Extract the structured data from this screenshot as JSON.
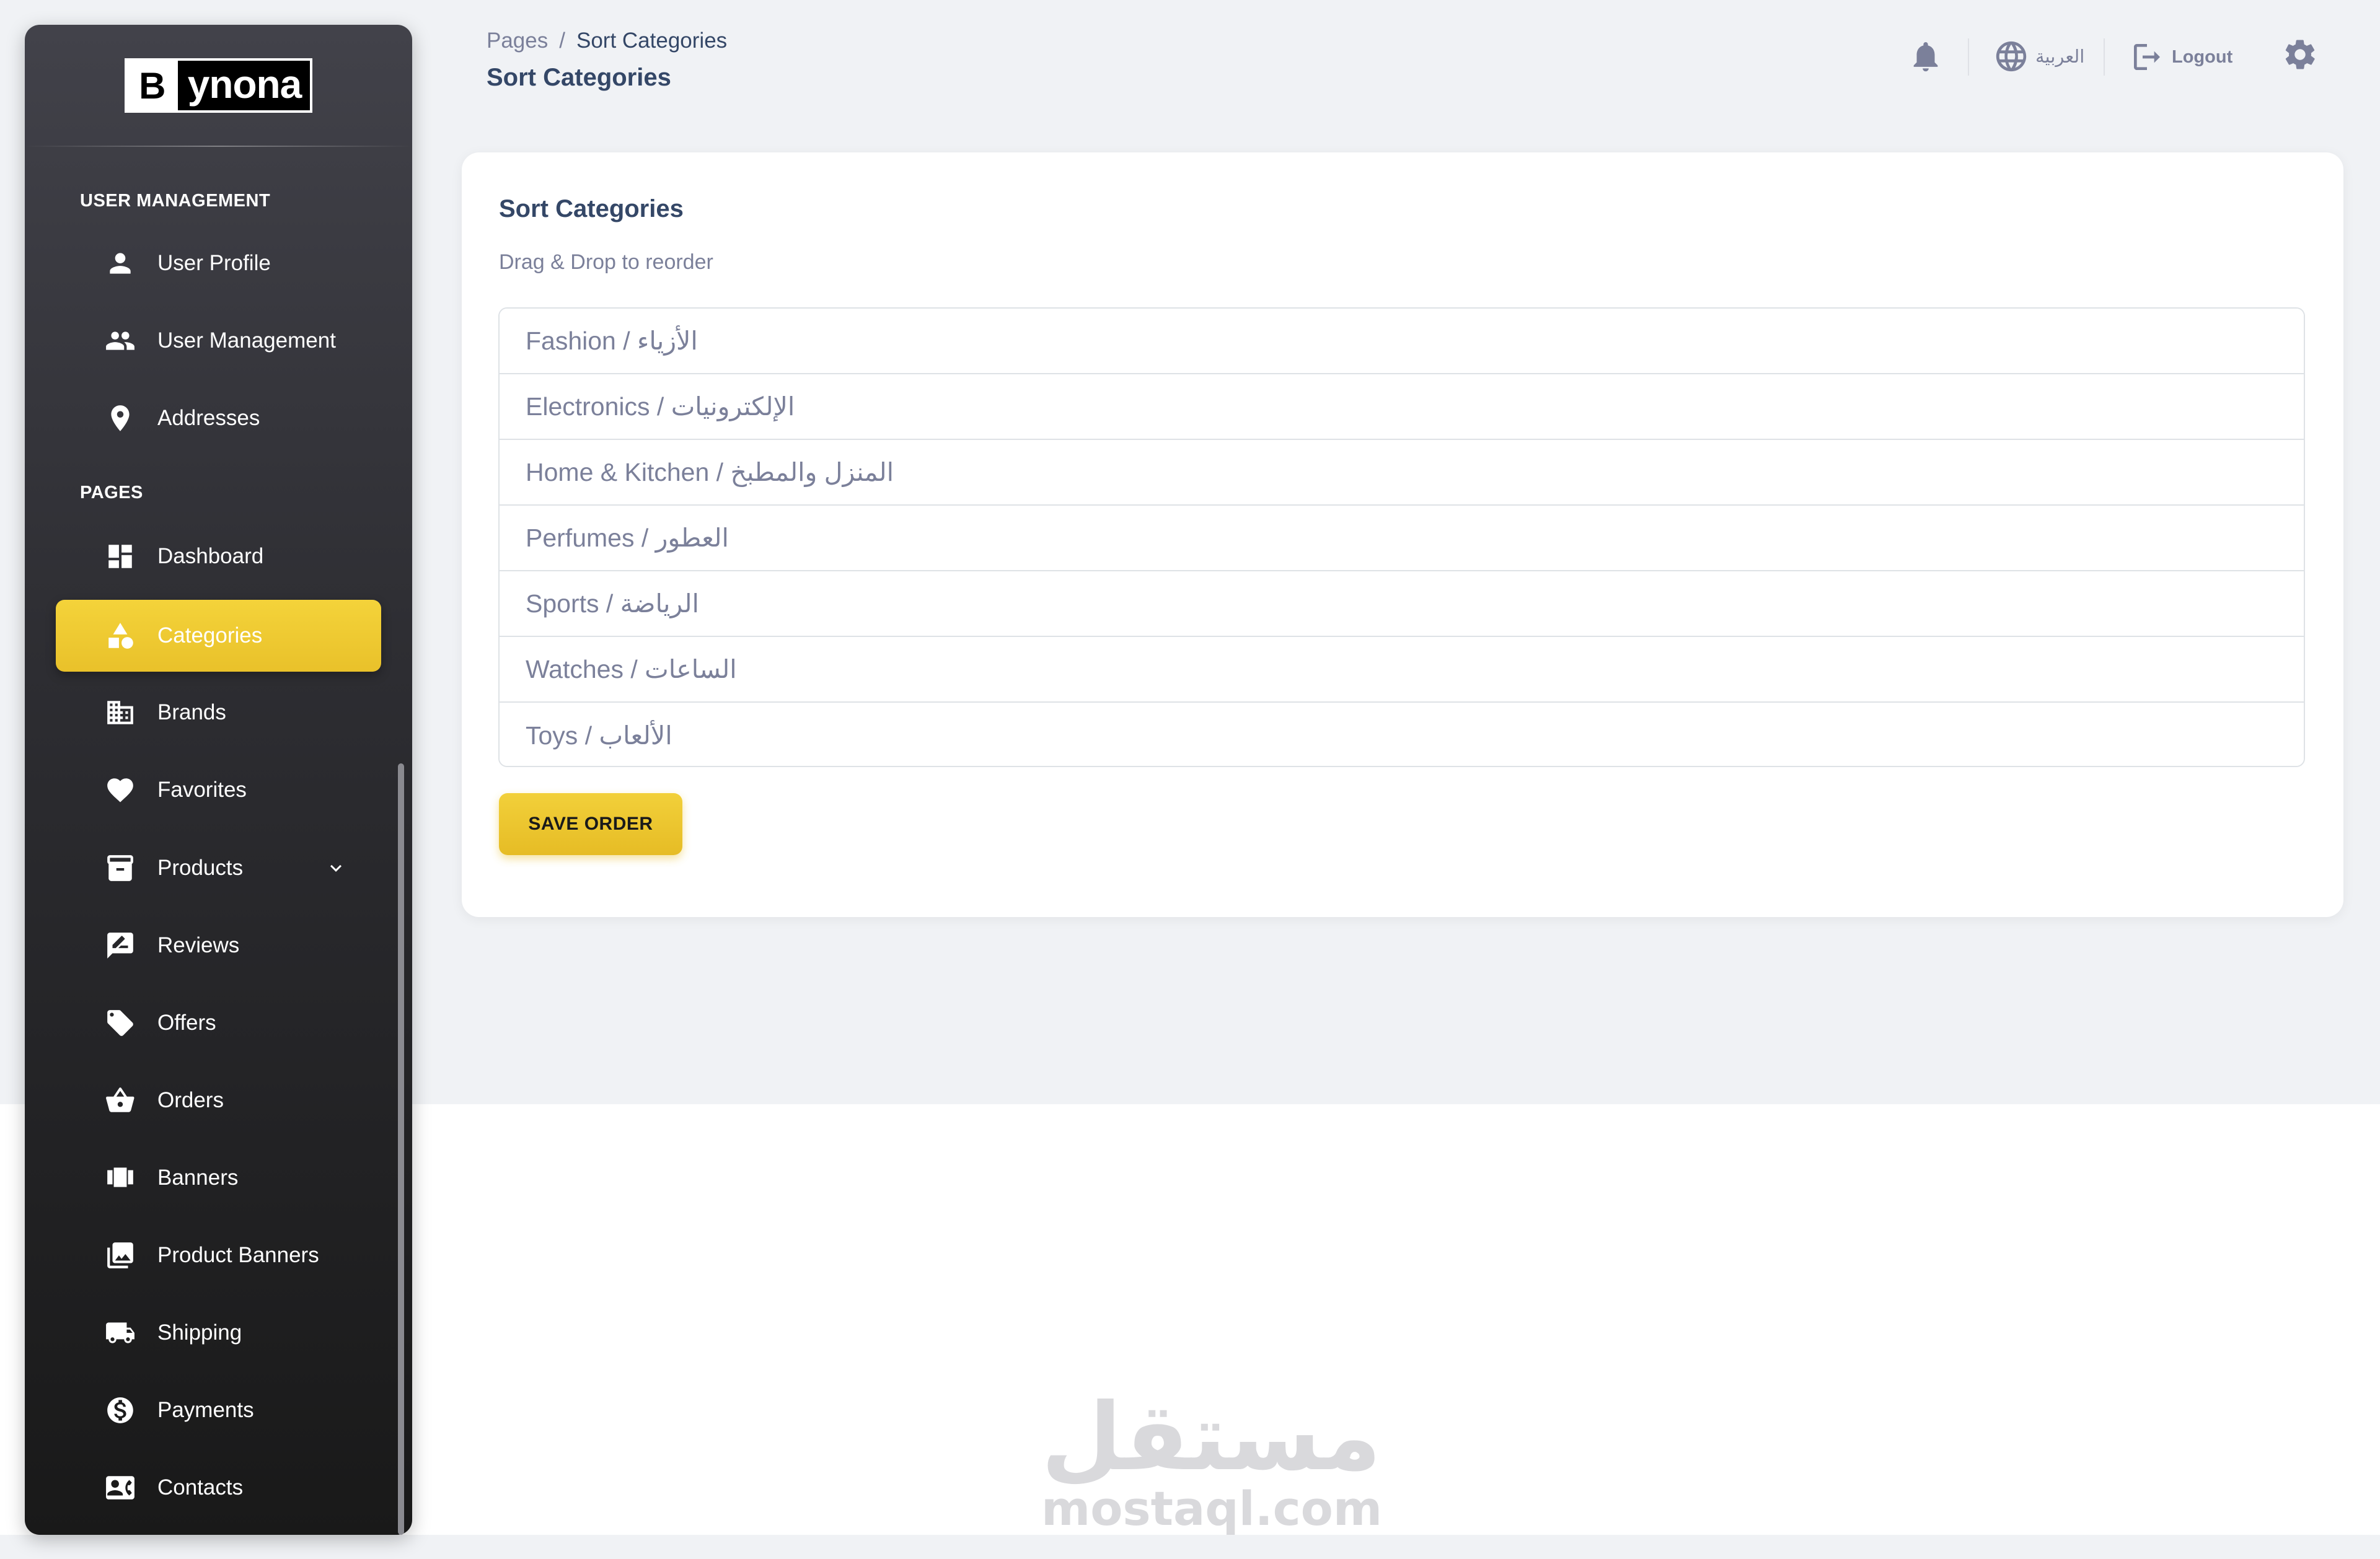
{
  "brand": {
    "logo_letter": "B",
    "logo_text": "ynona"
  },
  "sidebar": {
    "sections": [
      {
        "title": "USER MANAGEMENT"
      },
      {
        "title": "PAGES"
      }
    ],
    "items": [
      {
        "label": "User Profile",
        "icon": "person-icon"
      },
      {
        "label": "User Management",
        "icon": "people-icon"
      },
      {
        "label": "Addresses",
        "icon": "location-pin-icon"
      },
      {
        "label": "Dashboard",
        "icon": "dashboard-icon"
      },
      {
        "label": "Categories",
        "icon": "category-shapes-icon",
        "active": true
      },
      {
        "label": "Brands",
        "icon": "building-icon"
      },
      {
        "label": "Favorites",
        "icon": "heart-icon"
      },
      {
        "label": "Products",
        "icon": "archive-box-icon",
        "expandable": true
      },
      {
        "label": "Reviews",
        "icon": "rate-review-icon"
      },
      {
        "label": "Offers",
        "icon": "tag-icon"
      },
      {
        "label": "Orders",
        "icon": "shopping-basket-icon"
      },
      {
        "label": "Banners",
        "icon": "view-carousel-icon"
      },
      {
        "label": "Product Banners",
        "icon": "photo-library-icon"
      },
      {
        "label": "Shipping",
        "icon": "truck-icon"
      },
      {
        "label": "Payments",
        "icon": "dollar-circle-icon"
      },
      {
        "label": "Contacts",
        "icon": "contact-card-icon"
      }
    ]
  },
  "header": {
    "breadcrumb": {
      "parent": "Pages",
      "separator": "/",
      "current": "Sort Categories"
    },
    "title": "Sort Categories",
    "language_label": "العربية",
    "logout_label": "Logout"
  },
  "card": {
    "title": "Sort Categories",
    "subtitle": "Drag & Drop to reorder",
    "categories": [
      "Fashion / الأزياء",
      "Electronics / الإلكترونيات",
      "Home & Kitchen / المنزل والمطبخ",
      "Perfumes / العطور",
      "Sports / الرياضة",
      "Watches / الساعات",
      "Toys / الألعاب"
    ],
    "save_button": "SAVE ORDER"
  },
  "watermark": {
    "arabic": "مستقل",
    "latin": "mostaql.com"
  },
  "colors": {
    "accent": "#eac52c",
    "sidebar_top": "#42424a",
    "sidebar_bottom": "#191919",
    "background": "#f0f2f5",
    "text_primary": "#344767",
    "text_secondary": "#7b809a"
  }
}
